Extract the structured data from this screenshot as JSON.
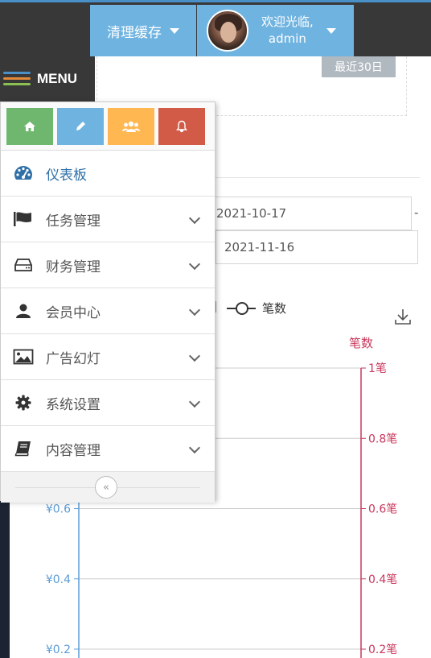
{
  "topbar": {
    "clear_cache_label": "清理缓存",
    "welcome_line1": "欢迎光临,",
    "welcome_line2": "admin"
  },
  "content": {
    "recent_button_label": "最近30日",
    "date_start": "2021-10-17",
    "date_separator": "-",
    "date_end": "2021-11-16",
    "legend_series_label": "笔数",
    "right_axis_label": "笔数"
  },
  "chart_data": {
    "type": "line",
    "y_left": {
      "ticks": [
        "¥0.6",
        "¥0.4",
        "¥0.2"
      ],
      "values": [
        0.6,
        0.4,
        0.2
      ]
    },
    "y_right": {
      "label": "笔数",
      "ticks": [
        "1笔",
        "0.8笔",
        "0.6笔",
        "0.4笔",
        "0.2笔"
      ],
      "values": [
        1,
        0.8,
        0.6,
        0.4,
        0.2
      ]
    },
    "series": [
      {
        "name": "笔数",
        "values": []
      }
    ],
    "colors": {
      "left_axis": "#5b9bd5",
      "right_axis": "#c9385c",
      "grid": "#cccccc"
    }
  },
  "menu": {
    "toggle_label": "MENU",
    "shortcuts": [
      {
        "icon": "home-icon",
        "color": "#6fb76f"
      },
      {
        "icon": "pencil-icon",
        "color": "#6fb3e0"
      },
      {
        "icon": "users-icon",
        "color": "#ffb752"
      },
      {
        "icon": "bell-icon",
        "color": "#d15b47"
      }
    ],
    "items": [
      {
        "label": "仪表板",
        "icon": "tachometer-icon"
      },
      {
        "label": "任务管理",
        "icon": "flag-icon"
      },
      {
        "label": "财务管理",
        "icon": "hdd-icon"
      },
      {
        "label": "会员中心",
        "icon": "user-icon"
      },
      {
        "label": "广告幻灯",
        "icon": "picture-icon"
      },
      {
        "label": "系统设置",
        "icon": "cog-icon"
      },
      {
        "label": "内容管理",
        "icon": "book-icon"
      }
    ],
    "collapse_glyph": "«"
  }
}
